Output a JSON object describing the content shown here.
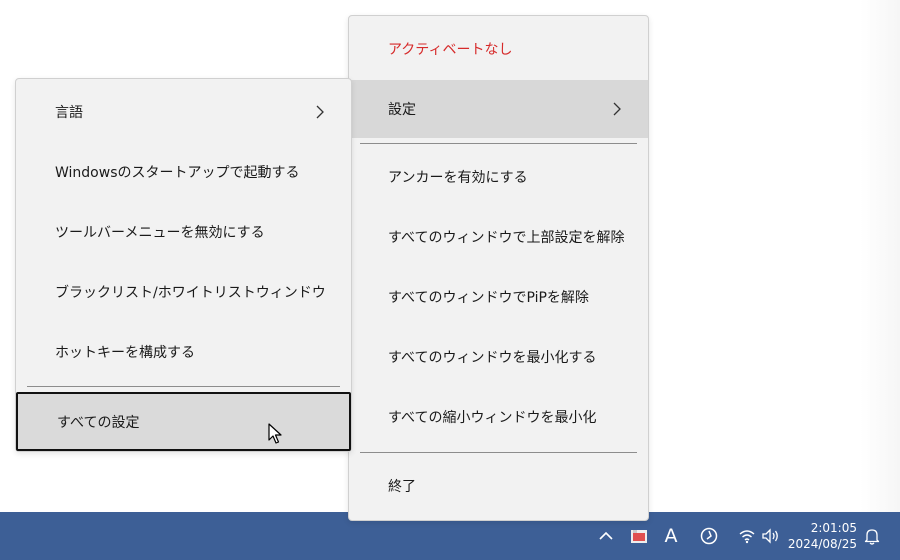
{
  "main_menu": {
    "items": [
      {
        "label": "アクティベートなし"
      },
      {
        "label": "設定"
      },
      {
        "label": "アンカーを有効にする"
      },
      {
        "label": "すべてのウィンドウで上部設定を解除"
      },
      {
        "label": "すべてのウィンドウでPiPを解除"
      },
      {
        "label": "すべてのウィンドウを最小化する"
      },
      {
        "label": "すべての縮小ウィンドウを最小化"
      },
      {
        "label": "終了"
      }
    ]
  },
  "settings_submenu": {
    "items": [
      {
        "label": "言語"
      },
      {
        "label": "Windowsのスタートアップで起動する"
      },
      {
        "label": "ツールバーメニューを無効にする"
      },
      {
        "label": "ブラックリスト/ホワイトリストウィンドウ"
      },
      {
        "label": "ホットキーを構成する"
      },
      {
        "label": "すべての設定"
      }
    ]
  },
  "taskbar": {
    "ime_label": "A",
    "clock_time": "2:01:05",
    "clock_date": "2024/08/25"
  },
  "colors": {
    "taskbar": "#3d5f96",
    "menu_bg": "#f2f2f2",
    "highlight": "#d8d8d8",
    "danger_text": "#d62a2a"
  },
  "icons": [
    "chevron-right-icon",
    "mouse-cursor-icon",
    "show-hidden-icons-chevron-up-icon",
    "app-tray-icon",
    "ime-mode-icon",
    "circle-app-icon",
    "wifi-icon",
    "speaker-icon",
    "notification-bell-icon"
  ]
}
